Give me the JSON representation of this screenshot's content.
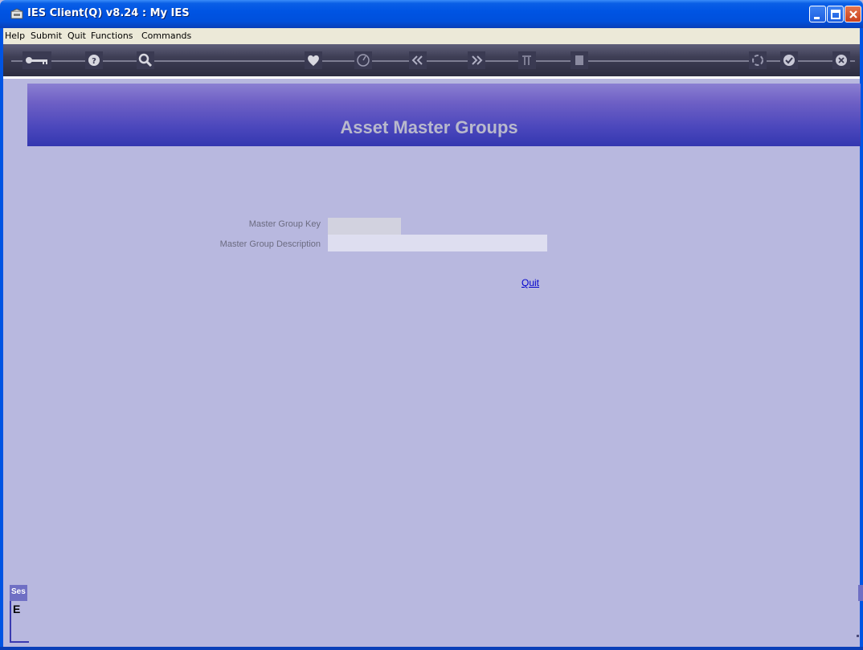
{
  "window": {
    "title": "IES Client(Q) v8.24 : My IES"
  },
  "menu": {
    "items": [
      "Help",
      "Submit",
      "Quit",
      "Functions",
      "Commands"
    ]
  },
  "toolbar": {
    "icons": [
      "key-icon",
      "help-icon",
      "search-icon",
      "heart-icon",
      "clock-icon",
      "previous-icon",
      "next-icon",
      "tools-icon",
      "list-icon",
      "recycle-icon",
      "checkmark-icon",
      "cancel-icon"
    ]
  },
  "header": {
    "title": "Asset Master Groups"
  },
  "form": {
    "key_label": "Master Group Key",
    "key_value": "",
    "description_label": "Master Group Description",
    "description_value": ""
  },
  "actions": {
    "quit_label": "Quit"
  },
  "session": {
    "tab_label": "Ses",
    "char": "E"
  },
  "colors": {
    "background": "#b8b8df",
    "banner_top": "#8b7fd2",
    "banner_bottom": "#3437b0",
    "title_text": "#b9b9cc",
    "link": "#0000cc"
  }
}
